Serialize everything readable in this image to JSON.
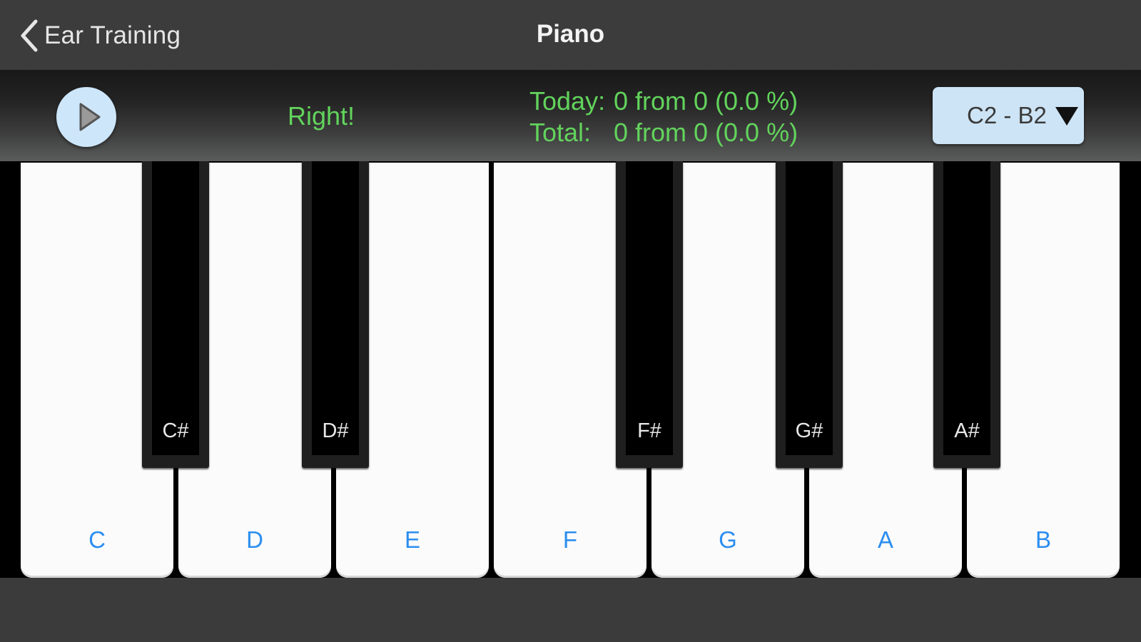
{
  "nav": {
    "back_label": "Ear Training",
    "title": "Piano"
  },
  "controls": {
    "play_icon": "play-icon",
    "result": "Right!",
    "stats": {
      "today_label": "Today:",
      "today_value": "0 from 0 (0.0 %)",
      "total_label": "Total:",
      "total_value": "0 from 0 (0.0 %)"
    },
    "range": "C2 - B2"
  },
  "keyboard": {
    "white_keys": [
      "C",
      "D",
      "E",
      "F",
      "G",
      "A",
      "B"
    ],
    "black_keys": [
      "C#",
      "D#",
      "F#",
      "G#",
      "A#"
    ]
  },
  "colors": {
    "accent_green": "#62d35c",
    "key_label_blue": "#2b8ef0",
    "button_light_blue": "#cde6fa"
  }
}
